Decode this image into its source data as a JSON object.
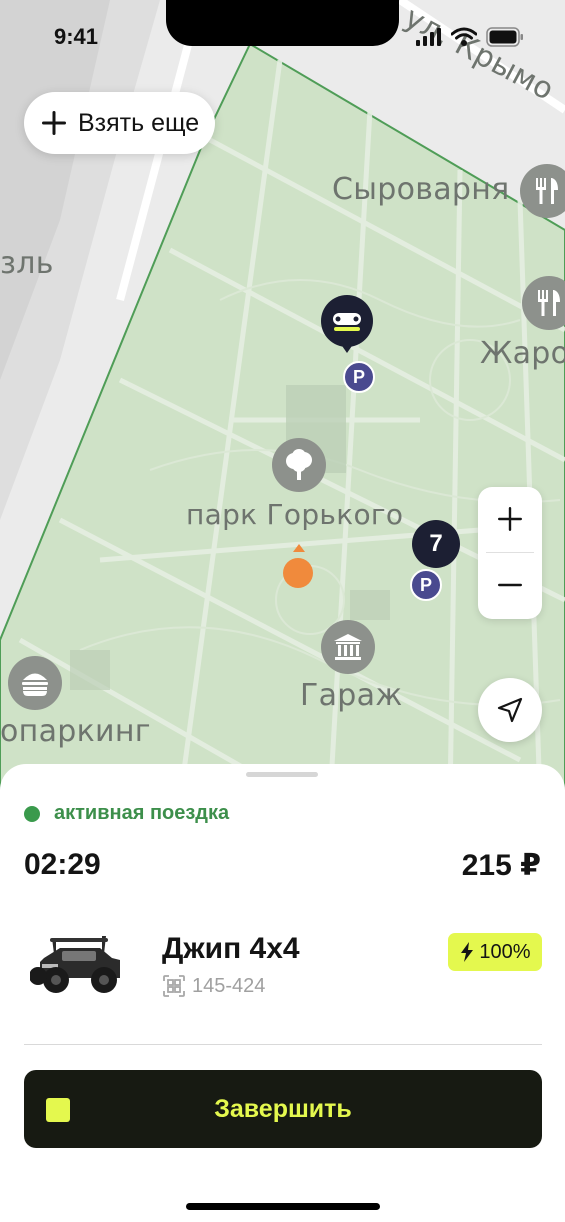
{
  "status_bar": {
    "time": "9:41"
  },
  "map": {
    "labels": {
      "street_top": "ул. Крымо",
      "left_edge": "зль",
      "cheese": "Сыроварня",
      "zharo": "Жаро",
      "park": "парк Горького",
      "garage": "Гараж",
      "parking": "опаркинг"
    },
    "cluster_count": "7",
    "parking_marker": "P",
    "zone_color": "#cfe2c7",
    "zone_border_color": "#4f9d57"
  },
  "take_more": {
    "label": "Взять еще"
  },
  "zoom": {
    "in_icon": "plus-icon",
    "out_icon": "minus-icon"
  },
  "locate": {
    "icon": "navigation-arrow-icon"
  },
  "ride": {
    "status": "активная поездка",
    "status_color": "#3a9a4c",
    "timer": "02:29",
    "price": "215 ₽"
  },
  "vehicle": {
    "name": "Джип 4х4",
    "code": "145-424",
    "battery": "100%",
    "image_icon": "toy-jeep-icon"
  },
  "finish": {
    "label": "Завершить"
  },
  "accent_color": "#e4f84e"
}
